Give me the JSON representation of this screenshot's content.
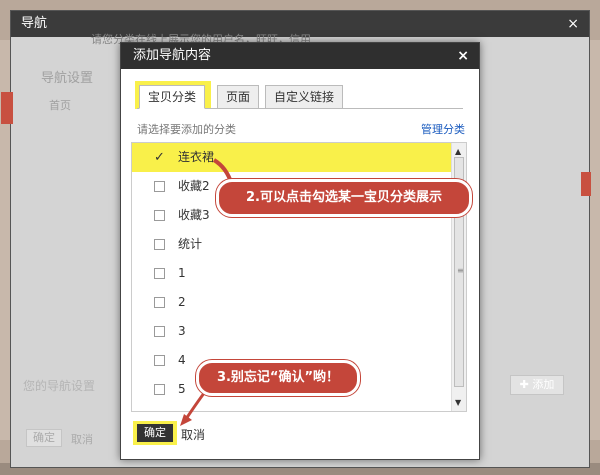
{
  "outer_dialog": {
    "title": "导航",
    "close": "×",
    "top_text": "请您分类在线上展示您的用户名，旺旺，信用",
    "nav_settings": "导航设置",
    "nav_home": "首页",
    "blurred_text": "您的导航设置",
    "add_button": "添加",
    "ok": "确定",
    "cancel": "取消"
  },
  "inner_dialog": {
    "title": "添加导航内容",
    "close": "×",
    "tabs": [
      {
        "label": "宝贝分类",
        "active": true
      },
      {
        "label": "页面",
        "active": false
      },
      {
        "label": "自定义链接",
        "active": false
      }
    ],
    "hint": "请选择要添加的分类",
    "manage_link": "管理分类",
    "categories": [
      {
        "label": "连衣裙",
        "checked": true
      },
      {
        "label": "收藏2",
        "checked": false
      },
      {
        "label": "收藏3",
        "checked": false
      },
      {
        "label": "统计",
        "checked": false
      },
      {
        "label": "1",
        "checked": false
      },
      {
        "label": "2",
        "checked": false
      },
      {
        "label": "3",
        "checked": false
      },
      {
        "label": "4",
        "checked": false
      },
      {
        "label": "5",
        "checked": false
      }
    ],
    "ok": "确定",
    "cancel": "取消"
  },
  "callouts": {
    "step2": "2.可以点击勾选某一宝贝分类展示",
    "step3": "3.别忘记“确认”哟！"
  },
  "colors": {
    "highlight": "#f9f04a",
    "callout_fill": "#c4463a",
    "title_bar": "#2f2f2f",
    "link": "#1a5bbf"
  }
}
